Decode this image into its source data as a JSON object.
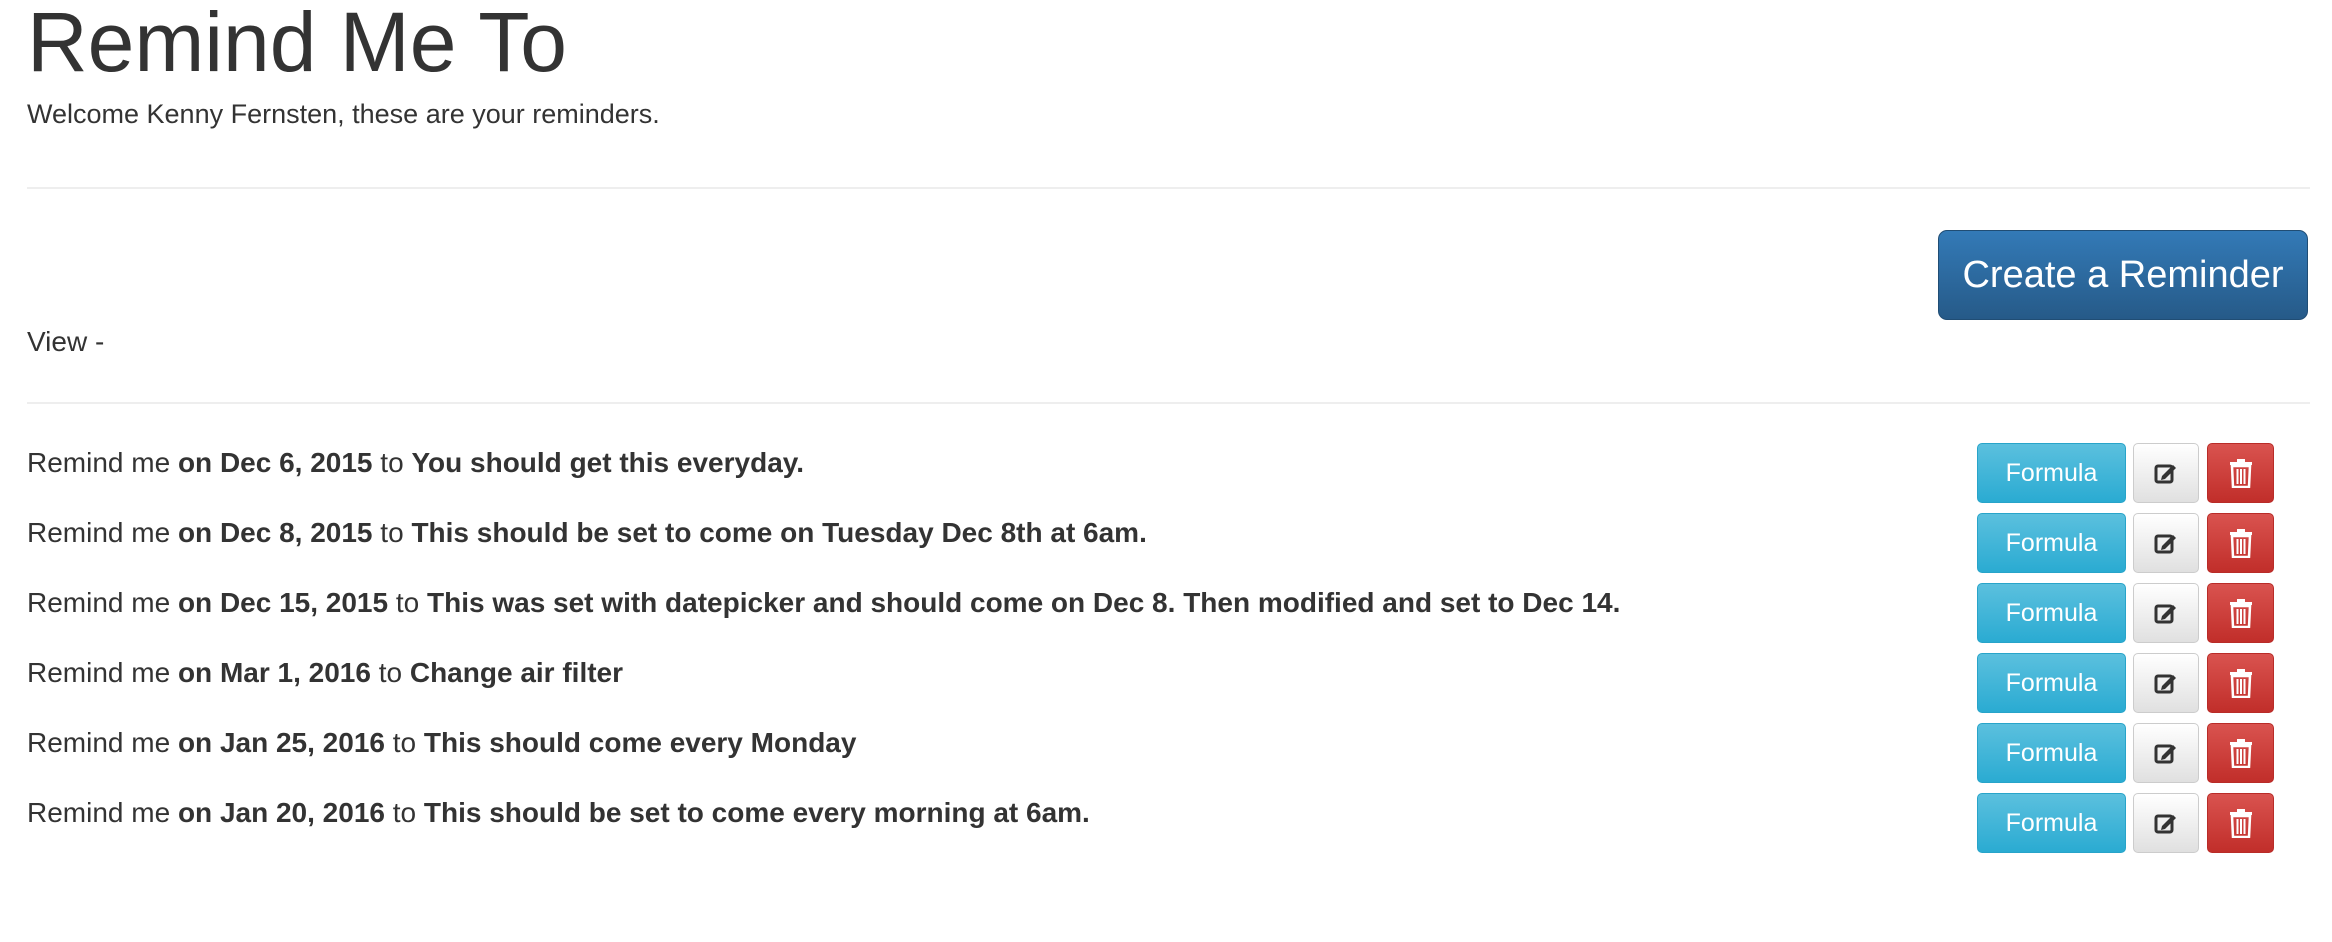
{
  "header": {
    "title": "Remind Me To",
    "welcome": "Welcome Kenny Fernsten, these are your reminders."
  },
  "toolbar": {
    "create_label": "Create a Reminder",
    "view_label": "View -"
  },
  "reminders": [
    {
      "prefix": "Remind me",
      "when": "on Dec 6, 2015",
      "joiner": "to",
      "what": "You should get this everyday."
    },
    {
      "prefix": "Remind me",
      "when": "on Dec 8, 2015",
      "joiner": "to",
      "what": "This should be set to come on Tuesday Dec 8th at 6am."
    },
    {
      "prefix": "Remind me",
      "when": "on Dec 15, 2015",
      "joiner": "to",
      "what": "This was set with datepicker and should come on Dec 8. Then modified and set to Dec 14."
    },
    {
      "prefix": "Remind me",
      "when": "on Mar 1, 2016",
      "joiner": "to",
      "what": "Change air filter"
    },
    {
      "prefix": "Remind me",
      "when": "on Jan 25, 2016",
      "joiner": "to",
      "what": "This should come every Monday"
    },
    {
      "prefix": "Remind me",
      "when": "on Jan 20, 2016",
      "joiner": "to",
      "what": "This should be set to come every morning at 6am."
    }
  ],
  "actions": {
    "formula_label": "Formula",
    "edit_icon": "edit-icon",
    "delete_icon": "trash-icon"
  },
  "colors": {
    "primary": "#337ab7",
    "info": "#5bc0de",
    "danger": "#d9534f",
    "default": "#e0e0e0",
    "text": "#333333"
  }
}
